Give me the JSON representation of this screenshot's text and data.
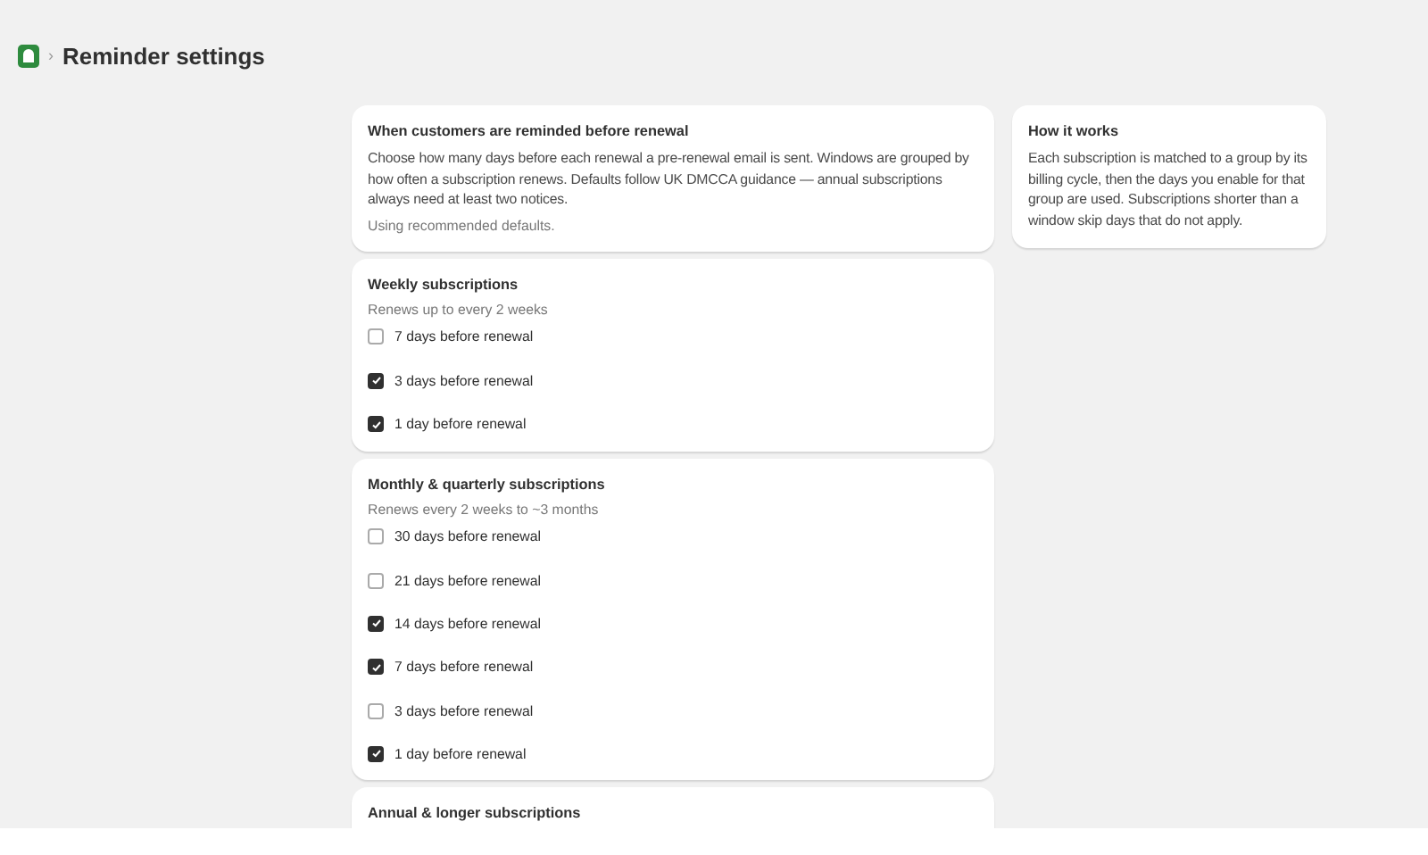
{
  "breadcrumb": {
    "separator": "›",
    "title": "Reminder settings"
  },
  "intro": {
    "title": "When customers are reminded before renewal",
    "body": "Choose how many days before each renewal a pre-renewal email is sent. Windows are grouped by how often a subscription renews. Defaults follow UK DMCCA guidance — annual subscriptions always need at least two notices.",
    "status": "Using recommended defaults."
  },
  "groups": [
    {
      "title": "Weekly subscriptions",
      "subtitle": "Renews up to every 2 weeks",
      "options": [
        {
          "label": "7 days before renewal",
          "checked": false
        },
        {
          "label": "3 days before renewal",
          "checked": true
        },
        {
          "label": "1 day before renewal",
          "checked": true
        }
      ]
    },
    {
      "title": "Monthly & quarterly subscriptions",
      "subtitle": "Renews every 2 weeks to ~3 months",
      "options": [
        {
          "label": "30 days before renewal",
          "checked": false
        },
        {
          "label": "21 days before renewal",
          "checked": false
        },
        {
          "label": "14 days before renewal",
          "checked": true
        },
        {
          "label": "7 days before renewal",
          "checked": true
        },
        {
          "label": "3 days before renewal",
          "checked": false
        },
        {
          "label": "1 day before renewal",
          "checked": true
        }
      ]
    },
    {
      "title": "Annual & longer subscriptions"
    }
  ],
  "help": {
    "title": "How it works",
    "body": "Each subscription is matched to a group by its billing cycle, then the days you enable for that group are used. Subscriptions shorter than a window skip days that do not apply."
  }
}
